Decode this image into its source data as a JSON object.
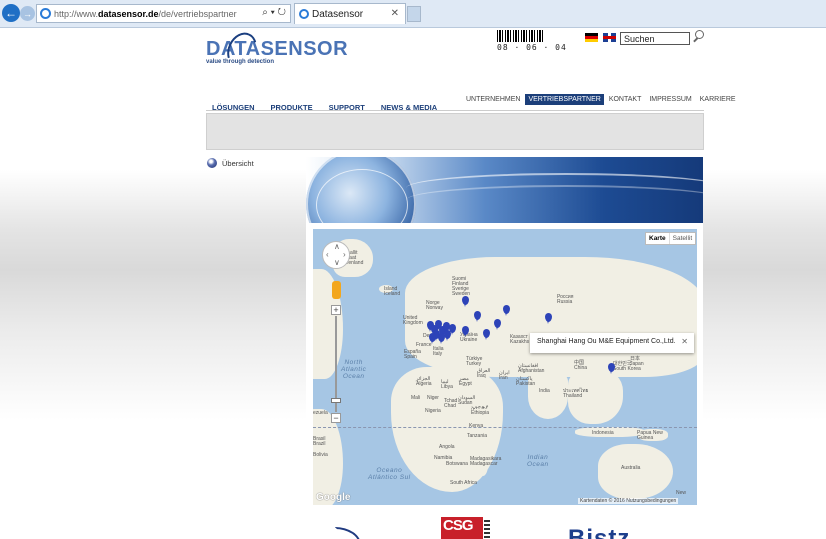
{
  "browser": {
    "url_prefix": "http://www.",
    "url_domain": "datasensor.de",
    "url_path": "/de/vertriebspartner",
    "url_tools": "⌕ ▾ ↻",
    "tab_title": "Datasensor",
    "tab_close": "✕",
    "back_glyph": "←",
    "fwd_glyph": "→"
  },
  "header": {
    "logo": "DATASENSOR",
    "tagline": "value through detection",
    "barcode_number": "08 · 06 · 04",
    "search_value": "Suchen"
  },
  "subnav": [
    "UNTERNEHMEN",
    "VERTRIEBSPARTNER",
    "KONTAKT",
    "IMPRESSUM",
    "KARRIERE"
  ],
  "subnav_active": "VERTRIEBSPARTNER",
  "mainnav": [
    "LÖSUNGEN",
    "PRODUKTE",
    "SUPPORT",
    "NEWS & MEDIA"
  ],
  "sidebar": {
    "item": "Übersicht"
  },
  "map": {
    "type_map": "Karte",
    "type_satellite": "Satellit",
    "zoom_in": "+",
    "zoom_out": "−",
    "pan_up": "∧",
    "pan_down": "∨",
    "pan_left": "‹",
    "pan_right": "›",
    "infobox_text": "Shanghai Hang Ou M&E Equipment Co.,Ltd.",
    "infobox_close": "✕",
    "google": "Google",
    "credits": "Kartendaten © 2016   Nutzungsbedingungen",
    "oceans": {
      "north_atlantic": "North\nAtlantic\nOcean",
      "south_atlantic": "Oceano\nAtlántico Sul",
      "indian": "Indian\nOcean"
    },
    "places": {
      "greenland": "Kalaallit\nNunaat\nGreenland",
      "iceland": "Island\nIceland",
      "sweden": "Suomi\nFinland\nSverige\nSweden",
      "norway": "Norge\nNorway",
      "uk": "United\nKingdom",
      "russia": "Россия\nRussia",
      "kazakhstan": "Казахст\nKazakhs",
      "deutschland": "Deut",
      "france": "France",
      "spain": "España\nSpain",
      "italy": "Italia\nItaly",
      "ukraine": "Україна\nUkraine",
      "turkey": "Türkiye\nTurkey",
      "iraq": "العراق\nIraq",
      "iran": "ایران\nIran",
      "afghanistan": "افغانستان\nAfghanistan",
      "pakistan": "پاکستان\nPakistan",
      "india": "India",
      "china": "中国\nChina",
      "korea": "대한민국\nSouth Korea",
      "japan": "日本\nJapan",
      "algeria": "الجزائر\nAlgeria",
      "libya": "ليبيا\nLibya",
      "egypt": "مصر\nEgypt",
      "mali": "Mali",
      "niger": "Niger",
      "chad": "Tchad\nChad",
      "sudan": "السودان\nSudan",
      "nigeria": "Nigeria",
      "ethiopia": "ኢትዮጵያ\nEthiopia",
      "kenya": "Kenya",
      "tanzania": "Tanzania",
      "angola": "Angola",
      "namibia": "Namibia",
      "botswana": "Botswana",
      "madagascar": "Madagasikara\nMadagascar",
      "south_africa": "South Africa",
      "indonesia": "Indonesia",
      "papua": "Papua New\nGuinea",
      "australia": "Australia",
      "thailand": "ประเทศไทย\nThailand",
      "brasil": "Brasil\nBrazil",
      "bolivia": "Bolivia",
      "venezuela": "ezuela",
      "new": "New"
    }
  },
  "partners": [
    "CSG"
  ]
}
